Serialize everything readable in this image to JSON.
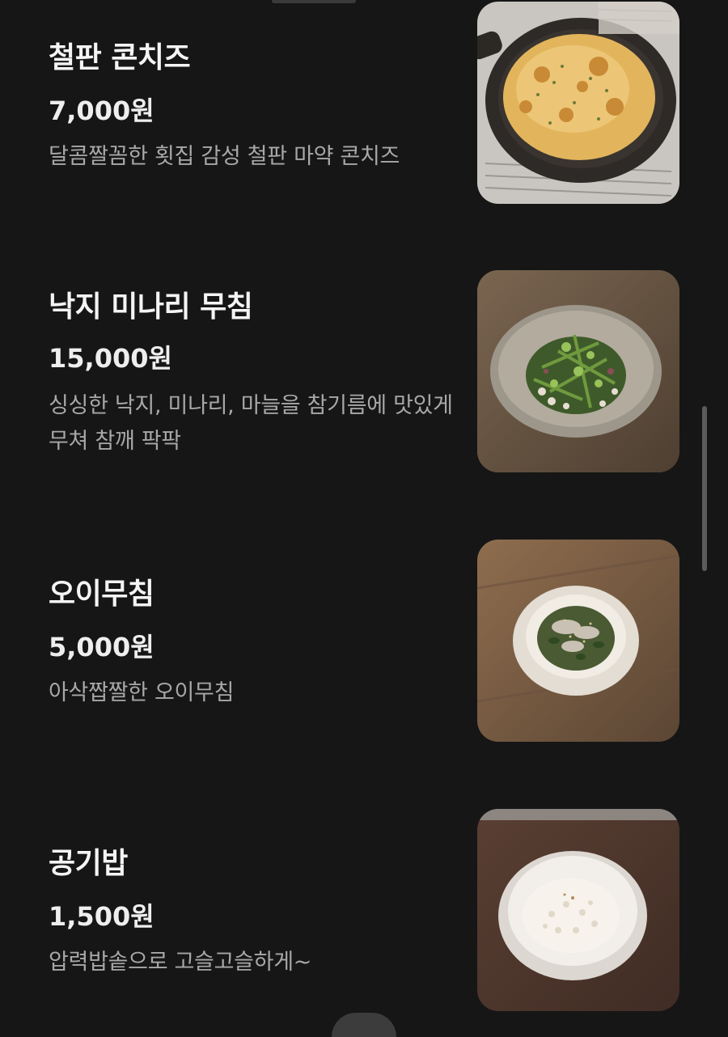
{
  "menu": {
    "items": [
      {
        "name": "철판 콘치즈",
        "price": "7,000원",
        "description": "달콤짤꼼한 횟집 감성 철판 마약 콘치즈",
        "photo_icon": "cheese-corn-skillet-photo"
      },
      {
        "name": "낙지 미나리 무침",
        "price": "15,000원",
        "description": "싱싱한 낙지, 미나리, 마늘을 참기름에 맛있게 무쳐 참깨 팍팍",
        "photo_icon": "octopus-dropwort-salad-photo"
      },
      {
        "name": "오이무침",
        "price": "5,000원",
        "description": "아삭짭짤한 오이무침",
        "photo_icon": "cucumber-salad-photo"
      },
      {
        "name": "공기밥",
        "price": "1,500원",
        "description": "압력밥솥으로 고슬고슬하게~",
        "photo_icon": "rice-bowl-photo"
      }
    ]
  },
  "colors": {
    "background": "#161616",
    "title": "#f4f4f4",
    "description": "#a8a8a8",
    "scrollbar": "#5b5b5b"
  }
}
